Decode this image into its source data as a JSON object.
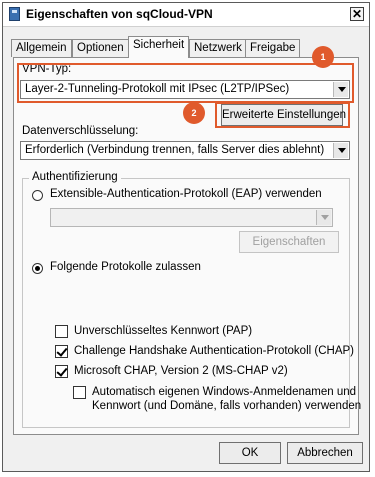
{
  "window": {
    "title": "Eigenschaften von sqCloud-VPN"
  },
  "tabs": [
    {
      "label": "Allgemein"
    },
    {
      "label": "Optionen"
    },
    {
      "label": "Sicherheit"
    },
    {
      "label": "Netzwerk"
    },
    {
      "label": "Freigabe"
    }
  ],
  "security": {
    "vpn_type_label": "VPN-Typ:",
    "vpn_type_value": "Layer-2-Tunneling-Protokoll mit IPsec (L2TP/IPSec)",
    "advanced_settings_label": "Erweiterte Einstellungen",
    "encryption_label": "Datenverschlüsselung:",
    "encryption_value": "Erforderlich (Verbindung trennen, falls Server dies ablehnt)"
  },
  "authentication": {
    "group_title": "Authentifizierung",
    "eap_radio_label": "Extensible-Authentication-Protokoll (EAP) verwenden",
    "eap_select_value": "",
    "properties_button_label": "Eigenschaften",
    "allow_protocols_radio_label": "Folgende Protokolle zulassen",
    "protocols": [
      {
        "label": "Unverschlüsseltes Kennwort (PAP)",
        "checked": false
      },
      {
        "label": "Challenge Handshake Authentication-Protokoll (CHAP)",
        "checked": true
      },
      {
        "label": "Microsoft CHAP, Version 2 (MS-CHAP v2)",
        "checked": true
      }
    ],
    "auto_logon_line1": "Automatisch eigenen Windows-Anmeldenamen und",
    "auto_logon_line2": "Kennwort (und Domäne, falls vorhanden) verwenden",
    "auto_logon_checked": false
  },
  "footer": {
    "ok_label": "OK",
    "cancel_label": "Abbrechen"
  },
  "callouts": {
    "badge1": "1",
    "badge2": "2",
    "color": "#e05a2c"
  }
}
